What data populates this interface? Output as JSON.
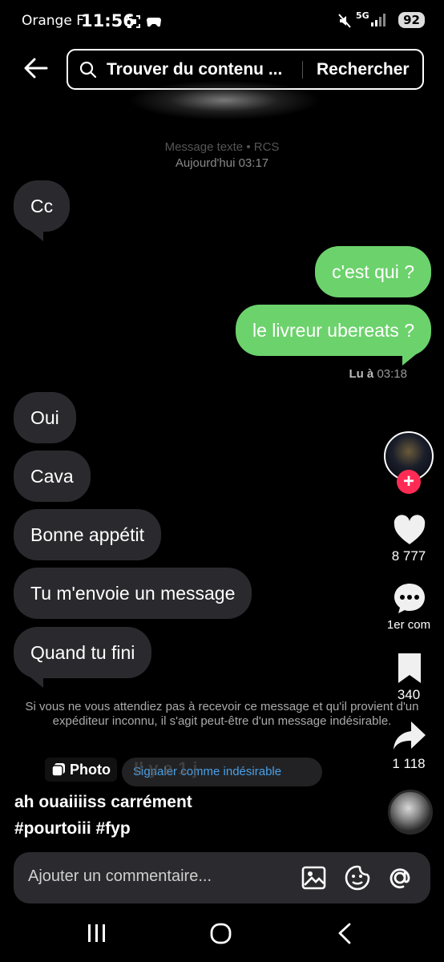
{
  "status_bar": {
    "carrier": "Orange F",
    "time": "11:56",
    "network": "5G",
    "battery": "92"
  },
  "header": {
    "search_placeholder": "Trouver du contenu ...",
    "search_button": "Rechercher"
  },
  "conversation": {
    "meta_type": "Message texte • RCS",
    "meta_date": "Aujourd'hui 03:17",
    "read_label": "Lu à",
    "read_time": "03:18",
    "messages": [
      {
        "side": "in",
        "text": "Cc"
      },
      {
        "side": "out",
        "text": "c'est qui ?"
      },
      {
        "side": "out",
        "text": "le livreur ubereats ?"
      },
      {
        "side": "in",
        "text": "Oui"
      },
      {
        "side": "in",
        "text": "Cava"
      },
      {
        "side": "in",
        "text": "Bonne appétit"
      },
      {
        "side": "in",
        "text": "Tu m'envoie un message"
      },
      {
        "side": "in",
        "text": "Quand tu fini"
      }
    ],
    "spam_warning": "Si vous ne vous attendiez pas à recevoir ce message et qu'il provient d'un expéditeur inconnu, il s'agit peut-être d'un message indésirable.",
    "report_label": "Signaler comme indésirable",
    "time_ago": "Il y a 1 j"
  },
  "video": {
    "photo_label": "Photo",
    "caption_line1": "ah ouaiiiiss carrément",
    "caption_line2": "#pourtoiii #fyp",
    "likes": "8 777",
    "comments": "1er com",
    "saves": "340",
    "shares": "1 118"
  },
  "comment_bar": {
    "placeholder": "Ajouter un commentaire..."
  },
  "colors": {
    "incoming_bubble": "#2a2a2e",
    "outgoing_bubble": "#6cd26c",
    "follow_plus": "#fe2c55",
    "link_blue": "#4aa0e6"
  }
}
